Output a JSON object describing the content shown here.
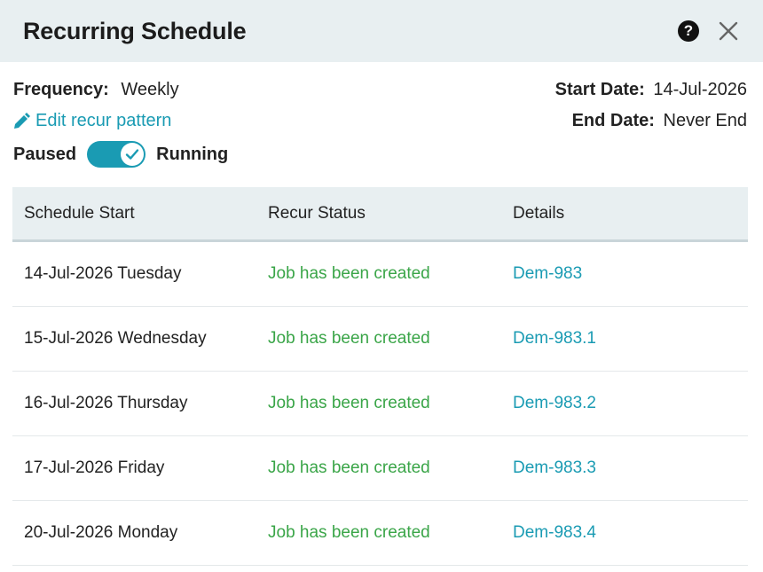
{
  "header": {
    "title": "Recurring Schedule",
    "help_symbol": "?"
  },
  "info": {
    "frequency_label": "Frequency:",
    "frequency_value": "Weekly",
    "edit_link": "Edit recur pattern",
    "toggle_left": "Paused",
    "toggle_right": "Running",
    "toggle_state": "Running",
    "start_date_label": "Start Date:",
    "start_date_value": "14-Jul-2026",
    "end_date_label": "End Date:",
    "end_date_value": "Never End"
  },
  "table": {
    "columns": [
      "Schedule Start",
      "Recur Status",
      "Details"
    ],
    "rows": [
      {
        "start": "14-Jul-2026 Tuesday",
        "status": "Job has been created",
        "details": "Dem-983"
      },
      {
        "start": "15-Jul-2026 Wednesday",
        "status": "Job has been created",
        "details": "Dem-983.1"
      },
      {
        "start": "16-Jul-2026 Thursday",
        "status": "Job has been created",
        "details": "Dem-983.2"
      },
      {
        "start": "17-Jul-2026 Friday",
        "status": "Job has been created",
        "details": "Dem-983.3"
      },
      {
        "start": "20-Jul-2026 Monday",
        "status": "Job has been created",
        "details": "Dem-983.4"
      }
    ]
  },
  "colors": {
    "accent": "#1a9bb3",
    "status_green": "#3aa548",
    "header_bg": "#e8eff1"
  }
}
